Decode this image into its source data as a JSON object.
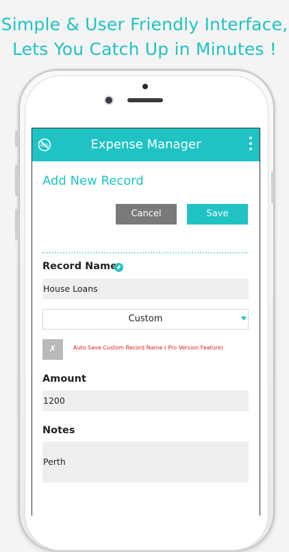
{
  "promo": {
    "line1": "Simple & User Friendly Interface,",
    "line2": "Lets You Catch Up in Minutes !"
  },
  "app": {
    "title": "Expense Manager",
    "page_title": "Add New Record",
    "icons": {
      "left": "no-ads-icon",
      "right": "overflow-menu-icon",
      "info": "edit-info-icon",
      "select": "dropdown-caret-icon"
    },
    "accent_color": "#1fc3c3"
  },
  "actions": {
    "cancel_label": "Cancel",
    "save_label": "Save"
  },
  "form": {
    "record_name_label": "Record Name",
    "record_name_value": "House Loans",
    "type_selected": "Custom",
    "autosave_check_mark": "✗",
    "autosave_text": "Auto Save Custom Record Name ( Pro Version Feature)",
    "amount_label": "Amount",
    "amount_value": "1200",
    "notes_label": "Notes",
    "notes_value": "Perth"
  }
}
